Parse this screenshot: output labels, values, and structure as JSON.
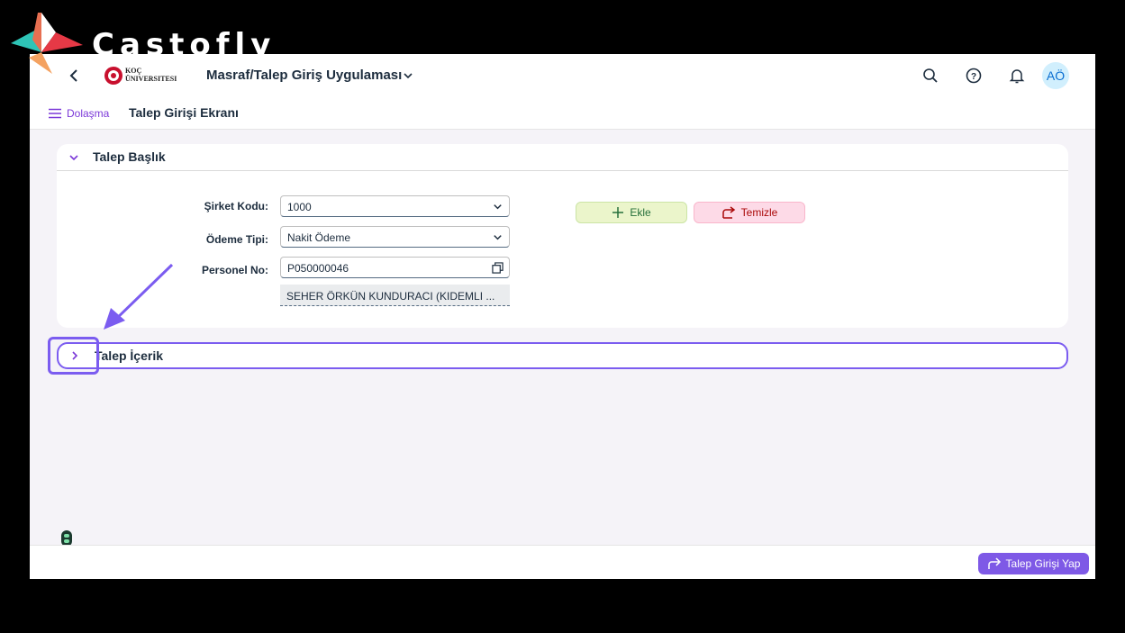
{
  "watermark": {
    "brand": "Castofly"
  },
  "shellbar": {
    "logo_line1": "KOÇ",
    "logo_line2": "ÜNIVERSITESI",
    "app_title": "Masraf/Talep Giriş Uygulaması",
    "avatar_initials": "AÖ",
    "icons": [
      "back-icon",
      "search-icon",
      "help-icon",
      "bell-icon"
    ]
  },
  "subheader": {
    "nav_label": "Dolaşma",
    "page_title": "Talep Girişi Ekranı"
  },
  "header_panel": {
    "title": "Talep Başlık",
    "fields": {
      "company_code_label": "Şirket Kodu:",
      "company_code_value": "1000",
      "payment_type_label": "Ödeme Tipi:",
      "payment_type_value": "Nakit Ödeme",
      "personnel_no_label": "Personel No:",
      "personnel_no_value": "P050000046",
      "personnel_name": "SEHER ÖRKÜN KUNDURACI (KIDEMLI ..."
    },
    "buttons": {
      "add": "Ekle",
      "clear": "Temizle"
    }
  },
  "content_panel": {
    "title": "Talep İçerik"
  },
  "footer": {
    "submit": "Talep Girişi Yap"
  },
  "colors": {
    "accent": "#7b5cf0",
    "nav": "#7b38d8",
    "add_bg": "#ebf5cb",
    "clear_bg": "#fddae7",
    "submit_bg": "#7e59e6"
  }
}
